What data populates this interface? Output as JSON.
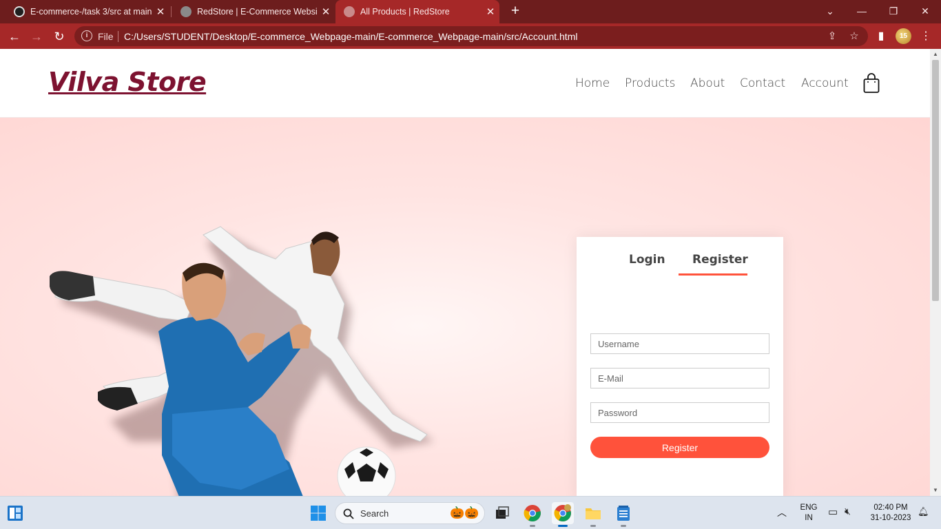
{
  "browser": {
    "tabs": [
      {
        "title": "E-commerce-/task 3/src at main"
      },
      {
        "title": "RedStore | E-Commerce Website"
      },
      {
        "title": "All Products | RedStore"
      }
    ],
    "new_tab_label": "+",
    "omnibox": {
      "scheme_label": "File",
      "url": "C:/Users/STUDENT/Desktop/E-commerce_Webpage-main/E-commerce_Webpage-main/src/Account.html"
    },
    "profile_badge": "15"
  },
  "site": {
    "logo": "Vilva Store",
    "nav": [
      "Home",
      "Products",
      "About",
      "Contact",
      "Account"
    ]
  },
  "form": {
    "tabs": {
      "login": "Login",
      "register": "Register"
    },
    "active_tab": "Register",
    "username_placeholder": "Username",
    "email_placeholder": "E-Mail",
    "password_placeholder": "Password",
    "submit_label": "Register",
    "accent_color": "#ff523b"
  },
  "taskbar": {
    "search_label": "Search",
    "language": "ENG",
    "region": "IN",
    "time": "02:40 PM",
    "date": "31-10-2023"
  },
  "colors": {
    "browser_frame": "#6d1d1d",
    "browser_toolbar": "#a62828",
    "logo": "#7d1230",
    "hero_background": "#ffd6d3"
  }
}
